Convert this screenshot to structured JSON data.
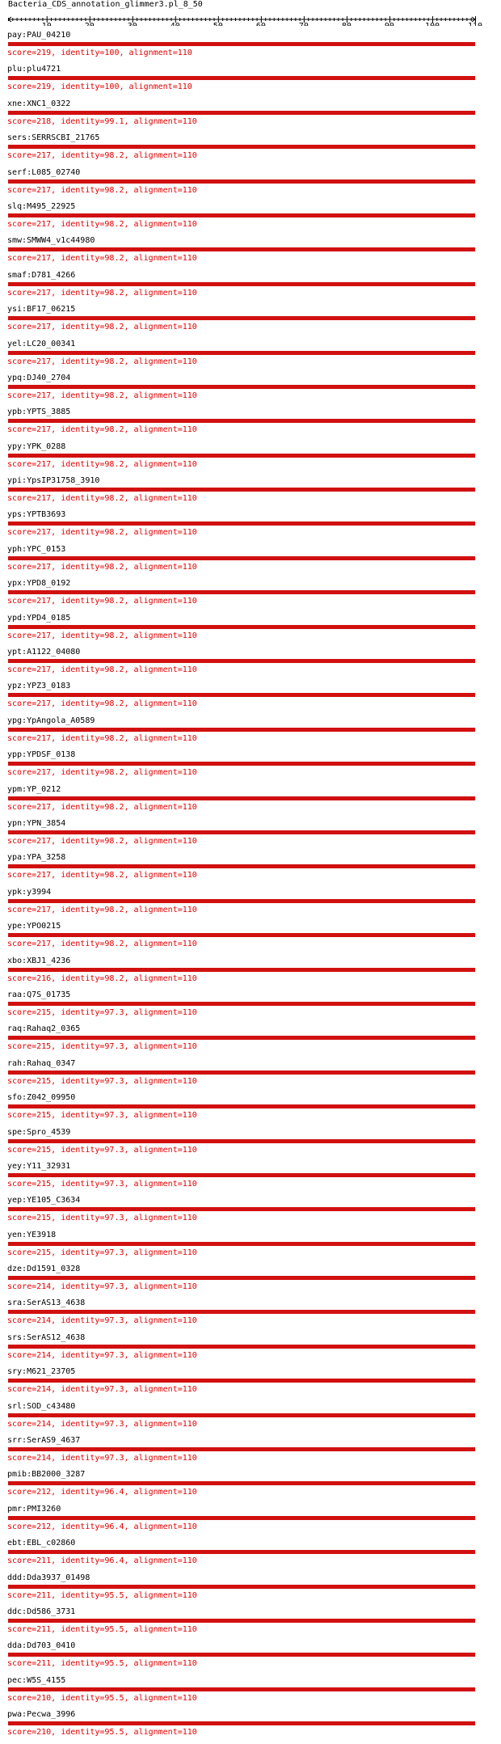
{
  "title": "Bacteria_CDS_annotation_glimmer3.pl_8_50",
  "ruler": {
    "start": 1,
    "end": 110,
    "tick_labels": [
      "10",
      "20",
      "30",
      "40",
      "50",
      "60",
      "70",
      "80",
      "90",
      "100",
      "110"
    ]
  },
  "colors": {
    "bar": "#d11010",
    "score_text": "#e00000"
  },
  "hits": [
    {
      "name": "pay:PAU_04210",
      "score": "score=219, identity=100, alignment=110"
    },
    {
      "name": "plu:plu4721",
      "score": "score=219, identity=100, alignment=110"
    },
    {
      "name": "xne:XNC1_0322",
      "score": "score=218, identity=99.1, alignment=110"
    },
    {
      "name": "sers:SERRSCBI_21765",
      "score": "score=217, identity=98.2, alignment=110"
    },
    {
      "name": "serf:L085_02740",
      "score": "score=217, identity=98.2, alignment=110"
    },
    {
      "name": "slq:M495_22925",
      "score": "score=217, identity=98.2, alignment=110"
    },
    {
      "name": "smw:SMWW4_v1c44980",
      "score": "score=217, identity=98.2, alignment=110"
    },
    {
      "name": "smaf:D781_4266",
      "score": "score=217, identity=98.2, alignment=110"
    },
    {
      "name": "ysi:BF17_06215",
      "score": "score=217, identity=98.2, alignment=110"
    },
    {
      "name": "yel:LC20_00341",
      "score": "score=217, identity=98.2, alignment=110"
    },
    {
      "name": "ypq:DJ40_2704",
      "score": "score=217, identity=98.2, alignment=110"
    },
    {
      "name": "ypb:YPTS_3885",
      "score": "score=217, identity=98.2, alignment=110"
    },
    {
      "name": "ypy:YPK_0288",
      "score": "score=217, identity=98.2, alignment=110"
    },
    {
      "name": "ypi:YpsIP31758_3910",
      "score": "score=217, identity=98.2, alignment=110"
    },
    {
      "name": "yps:YPTB3693",
      "score": "score=217, identity=98.2, alignment=110"
    },
    {
      "name": "yph:YPC_0153",
      "score": "score=217, identity=98.2, alignment=110"
    },
    {
      "name": "ypx:YPD8_0192",
      "score": "score=217, identity=98.2, alignment=110"
    },
    {
      "name": "ypd:YPD4_0185",
      "score": "score=217, identity=98.2, alignment=110"
    },
    {
      "name": "ypt:A1122_04080",
      "score": "score=217, identity=98.2, alignment=110"
    },
    {
      "name": "ypz:YPZ3_0183",
      "score": "score=217, identity=98.2, alignment=110"
    },
    {
      "name": "ypg:YpAngola_A0589",
      "score": "score=217, identity=98.2, alignment=110"
    },
    {
      "name": "ypp:YPDSF_0138",
      "score": "score=217, identity=98.2, alignment=110"
    },
    {
      "name": "ypm:YP_0212",
      "score": "score=217, identity=98.2, alignment=110"
    },
    {
      "name": "ypn:YPN_3854",
      "score": "score=217, identity=98.2, alignment=110"
    },
    {
      "name": "ypa:YPA_3258",
      "score": "score=217, identity=98.2, alignment=110"
    },
    {
      "name": "ypk:y3994",
      "score": "score=217, identity=98.2, alignment=110"
    },
    {
      "name": "ype:YPO0215",
      "score": "score=217, identity=98.2, alignment=110"
    },
    {
      "name": "xbo:XBJ1_4236",
      "score": "score=216, identity=98.2, alignment=110"
    },
    {
      "name": "raa:Q7S_01735",
      "score": "score=215, identity=97.3, alignment=110"
    },
    {
      "name": "raq:Rahaq2_0365",
      "score": "score=215, identity=97.3, alignment=110"
    },
    {
      "name": "rah:Rahaq_0347",
      "score": "score=215, identity=97.3, alignment=110"
    },
    {
      "name": "sfo:Z042_09950",
      "score": "score=215, identity=97.3, alignment=110"
    },
    {
      "name": "spe:Spro_4539",
      "score": "score=215, identity=97.3, alignment=110"
    },
    {
      "name": "yey:Y11_32931",
      "score": "score=215, identity=97.3, alignment=110"
    },
    {
      "name": "yep:YE105_C3634",
      "score": "score=215, identity=97.3, alignment=110"
    },
    {
      "name": "yen:YE3918",
      "score": "score=215, identity=97.3, alignment=110"
    },
    {
      "name": "dze:Dd1591_0328",
      "score": "score=214, identity=97.3, alignment=110"
    },
    {
      "name": "sra:SerAS13_4638",
      "score": "score=214, identity=97.3, alignment=110"
    },
    {
      "name": "srs:SerAS12_4638",
      "score": "score=214, identity=97.3, alignment=110"
    },
    {
      "name": "sry:M621_23705",
      "score": "score=214, identity=97.3, alignment=110"
    },
    {
      "name": "srl:SOD_c43480",
      "score": "score=214, identity=97.3, alignment=110"
    },
    {
      "name": "srr:SerAS9_4637",
      "score": "score=214, identity=97.3, alignment=110"
    },
    {
      "name": "pmib:BB2000_3287",
      "score": "score=212, identity=96.4, alignment=110"
    },
    {
      "name": "pmr:PMI3260",
      "score": "score=212, identity=96.4, alignment=110"
    },
    {
      "name": "ebt:EBL_c02860",
      "score": "score=211, identity=96.4, alignment=110"
    },
    {
      "name": "ddd:Dda3937_01498",
      "score": "score=211, identity=95.5, alignment=110"
    },
    {
      "name": "ddc:Dd586_3731",
      "score": "score=211, identity=95.5, alignment=110"
    },
    {
      "name": "dda:Dd703_0410",
      "score": "score=211, identity=95.5, alignment=110"
    },
    {
      "name": "pec:W5S_4155",
      "score": "score=210, identity=95.5, alignment=110"
    },
    {
      "name": "pwa:Pecwa_3996",
      "score": "score=210, identity=95.5, alignment=110"
    }
  ]
}
